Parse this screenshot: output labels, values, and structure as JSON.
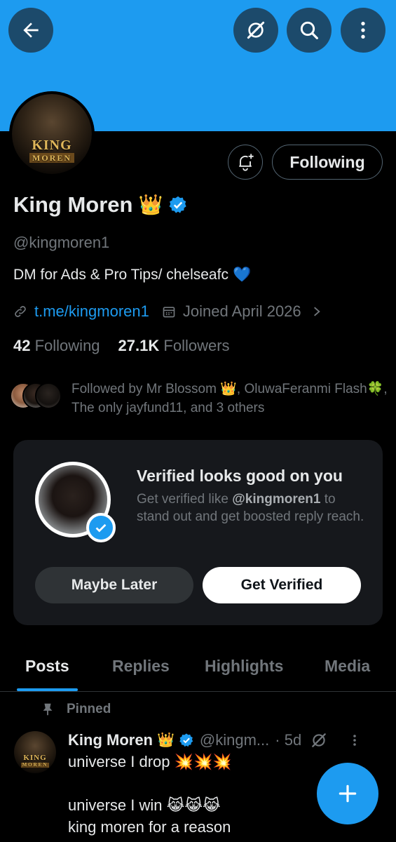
{
  "header": {
    "back_icon": "arrow-left-icon",
    "grok_icon": "grok-icon",
    "search_icon": "search-icon",
    "more_icon": "more-vertical-icon",
    "banner_color": "#1d9bf0"
  },
  "profile": {
    "avatar_text_top": "KING",
    "avatar_text_bottom": "MOREN",
    "display_name": "King Moren",
    "name_emoji": "👑",
    "handle": "@kingmoren1",
    "bio_text": "DM for Ads & Pro Tips/ chelseafc",
    "bio_emoji": "💙",
    "link": "t.me/kingmoren1",
    "joined": "Joined April 2026",
    "following_count": "42",
    "following_label": "Following",
    "followers_count": "27.1K",
    "followers_label": "Followers",
    "followed_by_text": "Followed by Mr Blossom 👑, OluwaFeranmi Flash🍀, The only jayfund11, and 3 others"
  },
  "actions": {
    "following_button": "Following",
    "bell_icon": "bell-plus-icon"
  },
  "verify_card": {
    "title": "Verified looks good on you",
    "desc_before": "Get verified like ",
    "desc_handle": "@kingmoren1",
    "desc_after": " to stand out and get boosted reply reach.",
    "maybe_later": "Maybe Later",
    "get_verified": "Get Verified"
  },
  "tabs": [
    "Posts",
    "Replies",
    "Highlights",
    "Media"
  ],
  "post": {
    "pinned_label": "Pinned",
    "author_name": "King Moren",
    "author_emoji": "👑",
    "author_handle": "@kingm...",
    "time": "· 5d",
    "line1": "universe I drop 💥💥💥",
    "line2": "universe I win 😹😹😹",
    "line3": "king moren for a reason"
  },
  "fab_icon": "plus-icon",
  "colors": {
    "accent": "#1d9bf0",
    "background": "#000000",
    "muted": "#71767b",
    "card": "#16181c"
  }
}
